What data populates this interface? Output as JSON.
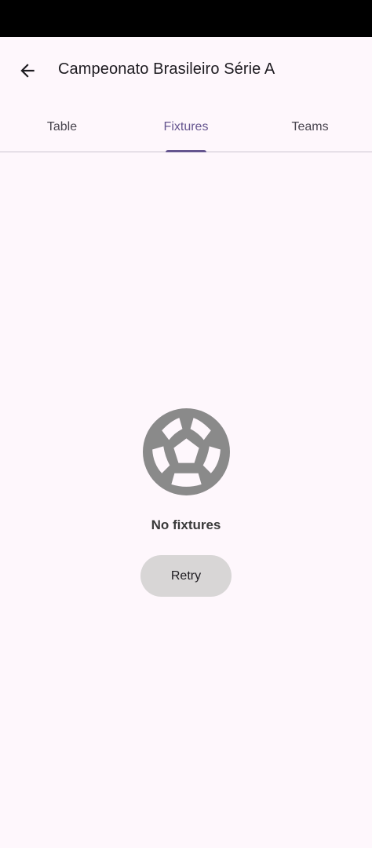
{
  "app_bar": {
    "back_icon": "arrow-back-icon",
    "title": "Campeonato Brasileiro Série A"
  },
  "tabs": [
    {
      "label": "Table",
      "active": false
    },
    {
      "label": "Fixtures",
      "active": true
    },
    {
      "label": "Teams",
      "active": false
    }
  ],
  "empty_state": {
    "icon": "soccer-ball-icon",
    "message": "No fixtures",
    "retry_label": "Retry"
  },
  "colors": {
    "background": "#fef7fc",
    "accent": "#65558f",
    "icon_gray": "#8a8a8a",
    "button_bg": "#d8d6d6"
  }
}
